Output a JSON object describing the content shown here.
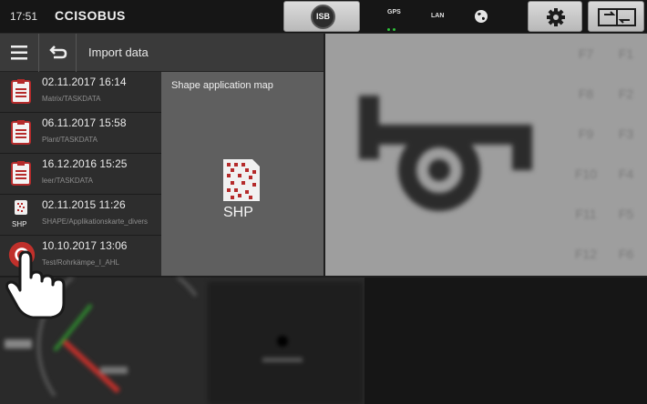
{
  "status": {
    "time": "17:51",
    "brand": "CCISOBUS",
    "isb_label": "ISB",
    "gps_label": "GPS",
    "lan_label": "LAN",
    "icons": [
      "globe-icon",
      "gear-icon",
      "swap-icon"
    ]
  },
  "menu": {
    "title": "Import data",
    "icons": [
      "menu-icon",
      "back-icon"
    ]
  },
  "files": [
    {
      "date": "02.11.2017 16:14",
      "path": "Matrix/TASKDATA",
      "icon": "taskdata-icon"
    },
    {
      "date": "06.11.2017 15:58",
      "path": "Plant/TASKDATA",
      "icon": "taskdata-icon"
    },
    {
      "date": "16.12.2016 15:25",
      "path": "leer/TASKDATA",
      "icon": "taskdata-icon"
    },
    {
      "date": "02.11.2015 11:26",
      "path": "SHAPE/Applikationskarte_divers",
      "icon": "shp-icon",
      "icon_label": "SHP"
    },
    {
      "date": "10.10.2017 13:06",
      "path": "Test/Rohrkämpe_I_AHL",
      "icon": "iso-file-icon"
    }
  ],
  "preview": {
    "title": "Shape application map",
    "icon_label": "SHP"
  },
  "fkeys": [
    "F7",
    "F1",
    "F8",
    "F2",
    "F9",
    "F3",
    "F10",
    "F4",
    "F11",
    "F5",
    "F12",
    "F6"
  ],
  "colors": {
    "accent_red": "#c0302b",
    "gps_green": "#2fc23a"
  }
}
